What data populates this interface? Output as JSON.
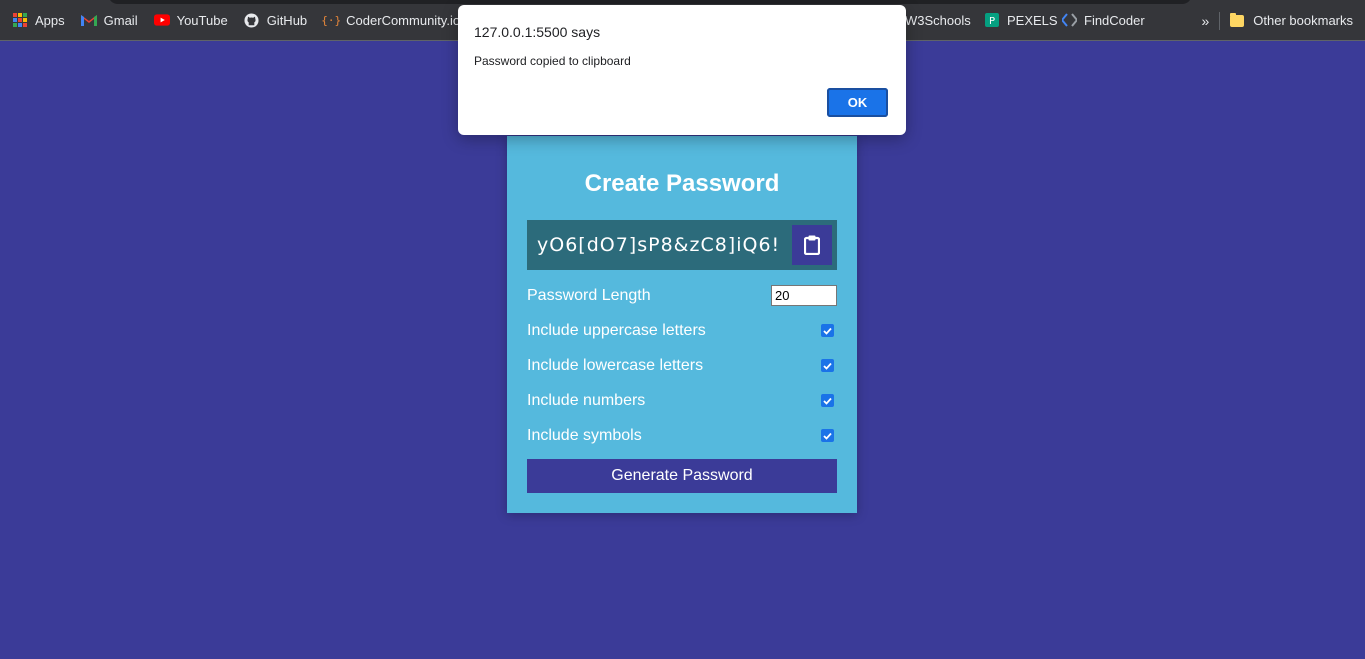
{
  "bookmarks": {
    "items": [
      {
        "label": "Apps",
        "icon": "apps-grid-icon"
      },
      {
        "label": "Gmail",
        "icon": "gmail-icon"
      },
      {
        "label": "YouTube",
        "icon": "youtube-icon"
      },
      {
        "label": "GitHub",
        "icon": "github-icon"
      },
      {
        "label": "CoderCommunity.io",
        "icon": "codercommunity-icon"
      },
      {
        "label": "W3Schools",
        "icon": "w3schools-icon"
      },
      {
        "label": "PEXELS",
        "icon": "pexels-icon"
      },
      {
        "label": "FindCoder",
        "icon": "findcoder-icon"
      }
    ],
    "more": "»",
    "other": "Other bookmarks"
  },
  "app": {
    "title": "Create Password",
    "password": "yO6[dO7]sP8&zC8]iQ6!",
    "length_label": "Password Length",
    "length_value": "20",
    "options": [
      {
        "label": "Include uppercase letters",
        "checked": true
      },
      {
        "label": "Include lowercase letters",
        "checked": true
      },
      {
        "label": "Include numbers",
        "checked": true
      },
      {
        "label": "Include symbols",
        "checked": true
      }
    ],
    "generate_label": "Generate Password"
  },
  "dialog": {
    "title": "127.0.0.1:5500 says",
    "message": "Password copied to clipboard",
    "ok_label": "OK"
  },
  "colors": {
    "background": "#3b3b98",
    "card": "#55b9dd",
    "result": "#2c6b7b",
    "accent": "#1a73e8"
  }
}
